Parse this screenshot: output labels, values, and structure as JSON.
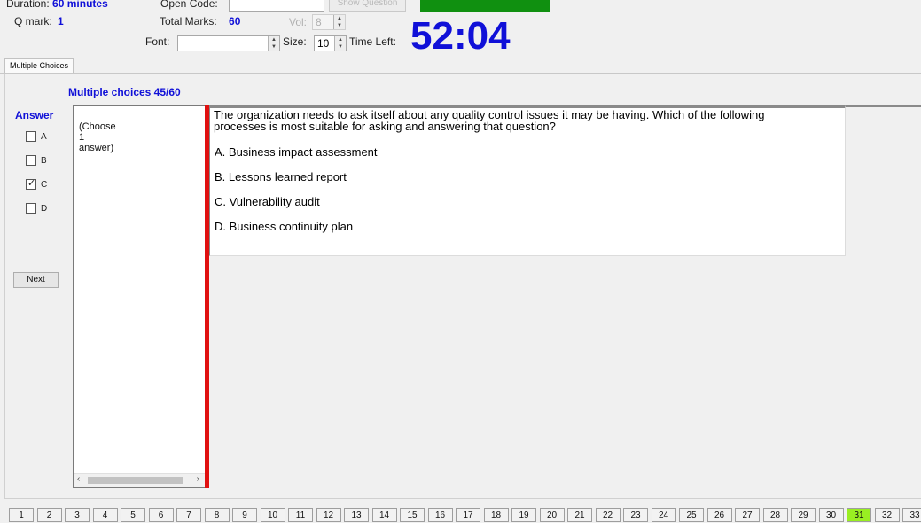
{
  "header": {
    "duration_label": "Duration:",
    "duration_value": "60 minutes",
    "open_code_label": "Open Code:",
    "show_question_label": "Show Question",
    "qmark_label": "Q mark:",
    "qmark_value": "1",
    "total_marks_label": "Total Marks:",
    "total_marks_value": "60",
    "vol_label": "Vol:",
    "vol_value": "8",
    "font_label": "Font:",
    "font_value": "",
    "size_label": "Size:",
    "size_value": "10",
    "time_left_label": "Time Left:",
    "timer": "52:04",
    "status_color": "#109010"
  },
  "tabs": [
    "Multiple Choices"
  ],
  "section_title": "Multiple choices 45/60",
  "answer": {
    "title": "Answer",
    "options": [
      {
        "label": "A",
        "checked": false
      },
      {
        "label": "B",
        "checked": false
      },
      {
        "label": "C",
        "checked": true
      },
      {
        "label": "D",
        "checked": false
      }
    ],
    "next_label": "Next"
  },
  "instruction": {
    "line1": "(Choose",
    "line2": "1",
    "line3": "answer)"
  },
  "question": {
    "line1": "The organization needs to ask itself about any quality control issues it may be having. Which of the following",
    "line2": "processes is most suitable for asking and answering that question?",
    "options": [
      "A.  Business impact assessment",
      "B.  Lessons learned report",
      "C.  Vulnerability audit",
      "D.  Business continuity plan"
    ]
  },
  "question_nav": {
    "numbers": [
      "1",
      "2",
      "3",
      "4",
      "5",
      "6",
      "7",
      "8",
      "9",
      "10",
      "11",
      "12",
      "13",
      "14",
      "15",
      "16",
      "17",
      "18",
      "19",
      "20",
      "21",
      "22",
      "23",
      "24",
      "25",
      "26",
      "27",
      "28",
      "29",
      "30",
      "31",
      "32",
      "33"
    ],
    "current": "31"
  },
  "colors": {
    "accent_blue": "#1010d8",
    "divider_red": "#e01010",
    "current_question": "#99ee22"
  }
}
